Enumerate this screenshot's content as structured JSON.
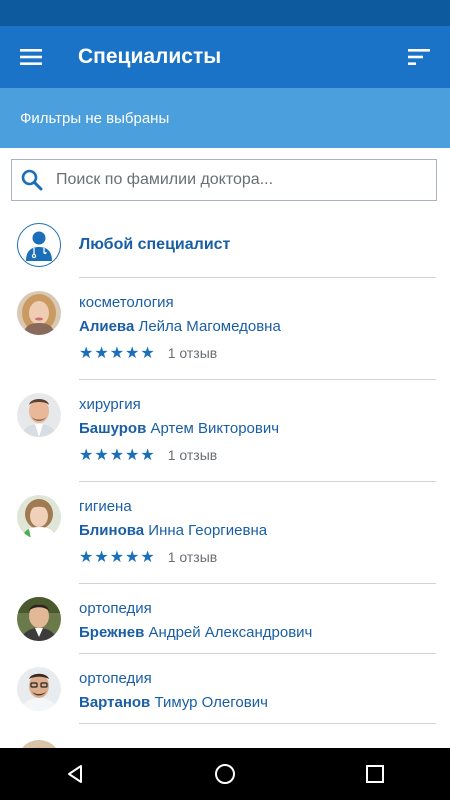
{
  "app_bar": {
    "title": "Специалисты",
    "menu_icon": "menu-icon",
    "sort_icon": "sort-icon"
  },
  "filters": {
    "status": "Фильтры не выбраны"
  },
  "search": {
    "placeholder": "Поиск по фамилии доктора..."
  },
  "any_specialist": {
    "label": "Любой специалист"
  },
  "doctors": [
    {
      "specialty": "косметология",
      "last_name": "Алиева",
      "first_names": "Лейла Магомедовна",
      "stars": "★★★★★",
      "rating": 5,
      "reviews": "1 отзыв"
    },
    {
      "specialty": "хирургия",
      "last_name": "Башуров",
      "first_names": "Артем Викторович",
      "stars": "★★★★★",
      "rating": 5,
      "reviews": "1 отзыв"
    },
    {
      "specialty": "гигиена",
      "last_name": "Блинова",
      "first_names": "Инна Георгиевна",
      "stars": "★★★★★",
      "rating": 5,
      "reviews": "1 отзыв"
    },
    {
      "specialty": "ортопедия",
      "last_name": "Брежнев",
      "first_names": "Андрей Александрович"
    },
    {
      "specialty": "ортопедия",
      "last_name": "Вартанов",
      "first_names": "Тимур Олегович"
    }
  ],
  "colors": {
    "status_bar": "#0d5a9e",
    "app_bar": "#1a73c6",
    "filter_bar": "#4a9fdc",
    "accent": "#1a5fa6"
  }
}
